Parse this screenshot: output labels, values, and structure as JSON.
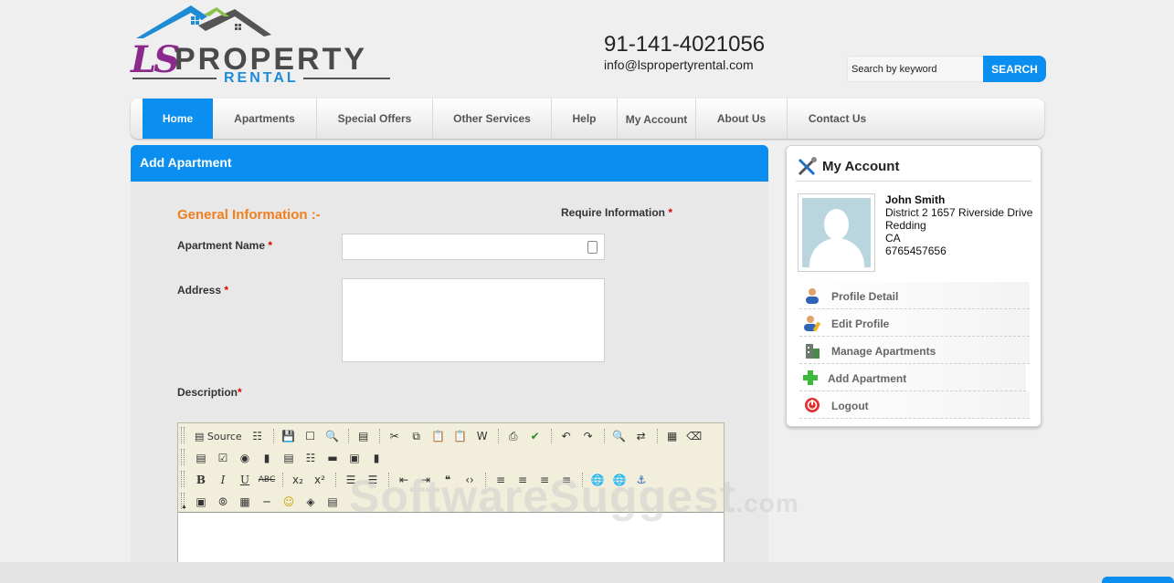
{
  "brand": {
    "ls": "LS",
    "property": "PROPERTY",
    "rental": "RENTAL"
  },
  "contact": {
    "phone": "91-141-4021056",
    "email": "info@lspropertyrental.com"
  },
  "search": {
    "placeholder": "Search by keyword",
    "button": "SEARCH"
  },
  "nav": [
    "Home",
    "Apartments",
    "Special Offers",
    "Other Services",
    "Help",
    "My Account",
    "About Us",
    "Contact Us"
  ],
  "form": {
    "title": "Add Apartment",
    "section": "General Information :-",
    "require": "Require Information",
    "star": "*",
    "apartment_name_label": "Apartment Name",
    "address_label": "Address",
    "description_label": "Description",
    "source_label": "Source"
  },
  "account": {
    "title": "My Account",
    "name": "John Smith",
    "address": "District 2 1657 Riverside Drive",
    "city": "Redding",
    "state": "CA",
    "phone": "6765457656",
    "menu": [
      "Profile Detail",
      "Edit Profile",
      "Manage Apartments",
      "Add Apartment",
      "Logout"
    ]
  },
  "watermark": {
    "main": "SoftwareSuggest",
    "suffix": ".com"
  }
}
